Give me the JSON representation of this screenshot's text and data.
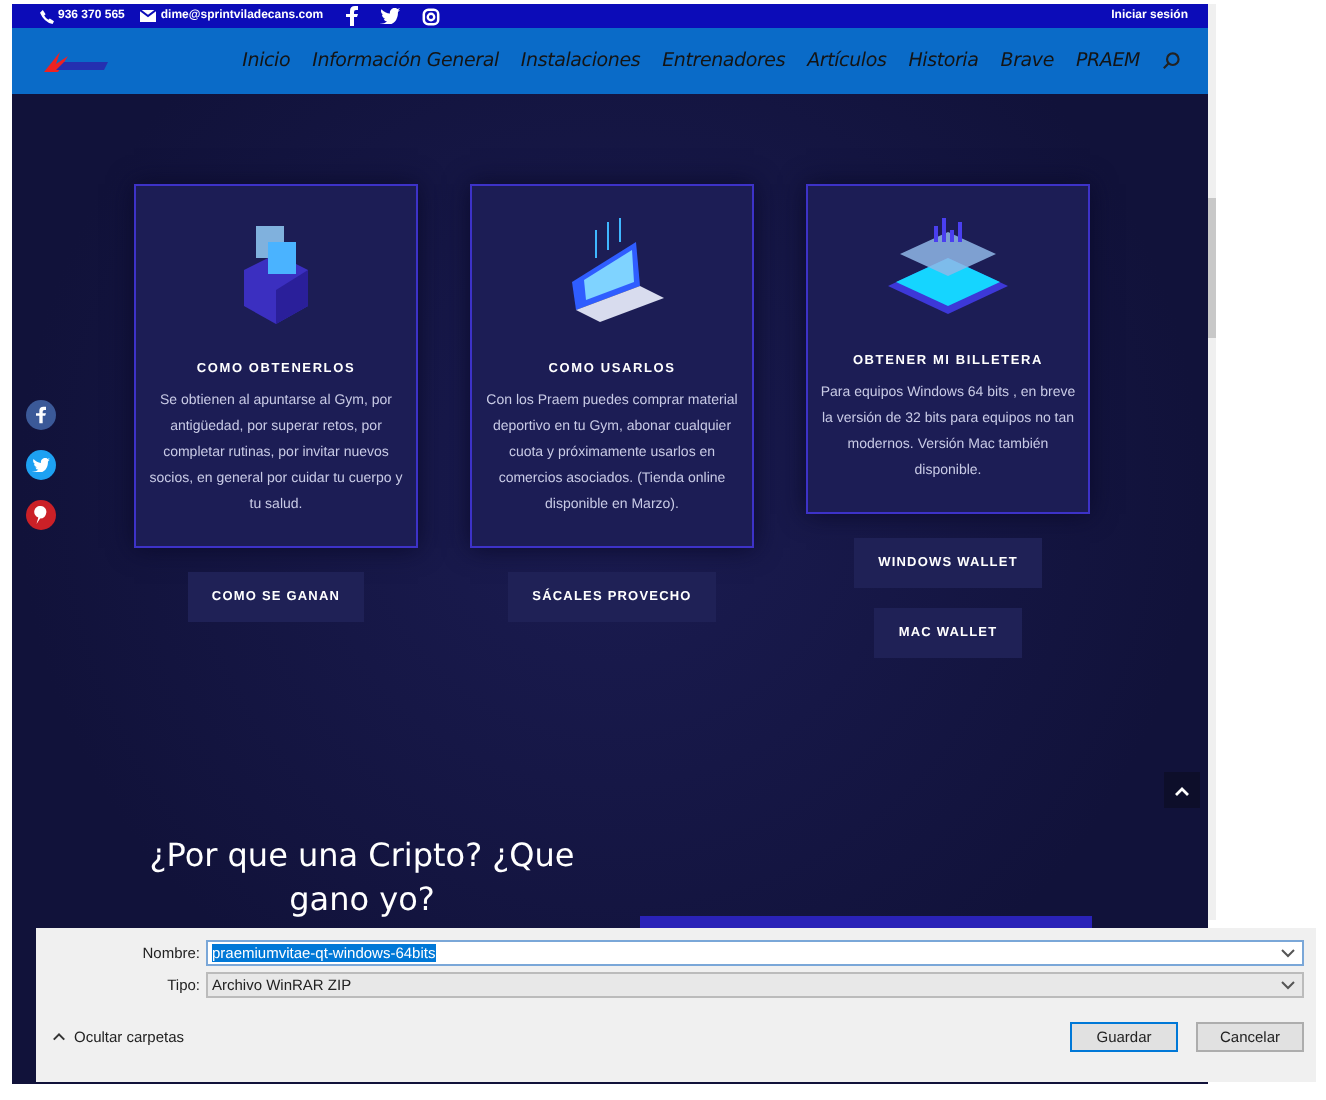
{
  "top_bar": {
    "phone": "936 370 565",
    "email": "dime@sprintviladecans.com",
    "login": "Iniciar sesión"
  },
  "nav": {
    "items": [
      "Inicio",
      "Información General",
      "Instalaciones",
      "Entrenadores",
      "Artículos",
      "Historia",
      "Brave",
      "PRAEM"
    ]
  },
  "cards": [
    {
      "kind": "box",
      "title": "COMO OBTENERLOS",
      "text": "Se obtienen al apuntarse al Gym, por antigüedad, por superar retos, por completar rutinas, por invitar nuevos socios, en general por cuidar tu cuerpo y tu salud.",
      "buttons": [
        "COMO SE GANAN"
      ]
    },
    {
      "kind": "laptop",
      "title": "COMO USARLOS",
      "text": "Con los Praem puedes comprar material deportivo en tu Gym, abonar cualquier cuota y próximamente usarlos en comercios asociados. (Tienda online disponible en Marzo).",
      "buttons": [
        "SÁCALES PROVECHO"
      ]
    },
    {
      "kind": "chart",
      "title": "OBTENER MI BILLETERA",
      "text": "Para equipos Windows 64 bits , en breve  la versión de 32 bits para equipos no tan modernos. Versión Mac también disponible.",
      "buttons": [
        "WINDOWS WALLET",
        "MAC WALLET"
      ]
    }
  ],
  "section": {
    "heading": "¿Por que una Cripto? ¿Que gano yo?"
  },
  "save_dialog": {
    "fields": [
      {
        "label": "Nombre:",
        "value": "praemiumvitae-qt-windows-64bits",
        "selected": true
      },
      {
        "label": "Tipo:",
        "value": "Archivo WinRAR ZIP",
        "selected": false
      }
    ],
    "toggle": "Ocultar carpetas",
    "buttons": [
      {
        "label": "Guardar",
        "default": true
      },
      {
        "label": "Cancelar",
        "default": false
      }
    ]
  }
}
